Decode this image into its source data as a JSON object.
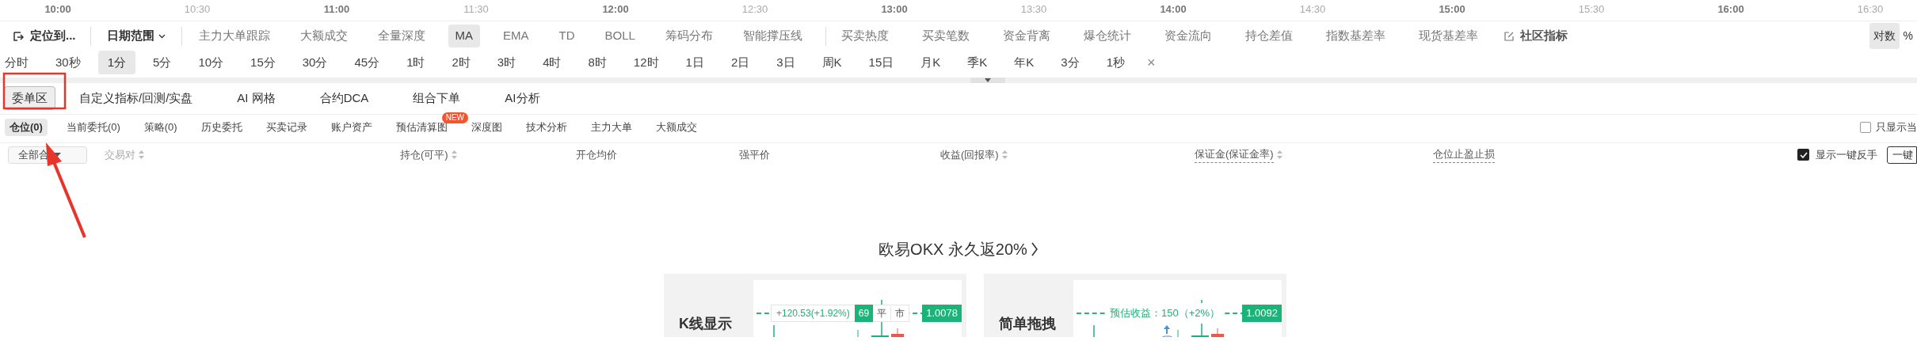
{
  "time_axis": [
    {
      "label": "10:00",
      "major": true
    },
    {
      "label": "10:30",
      "major": false
    },
    {
      "label": "11:00",
      "major": true
    },
    {
      "label": "11:30",
      "major": false
    },
    {
      "label": "12:00",
      "major": true
    },
    {
      "label": "12:30",
      "major": false
    },
    {
      "label": "13:00",
      "major": true
    },
    {
      "label": "13:30",
      "major": false
    },
    {
      "label": "14:00",
      "major": true
    },
    {
      "label": "14:30",
      "major": false
    },
    {
      "label": "15:00",
      "major": true
    },
    {
      "label": "15:30",
      "major": false
    },
    {
      "label": "16:00",
      "major": true
    },
    {
      "label": "16:30",
      "major": false
    }
  ],
  "toolbar": {
    "locate": "定位到...",
    "date_range": "日期范围",
    "indicators": [
      {
        "label": "主力大单跟踪",
        "selected": false
      },
      {
        "label": "大额成交",
        "selected": false
      },
      {
        "label": "全量深度",
        "selected": false
      },
      {
        "label": "MA",
        "selected": true
      },
      {
        "label": "EMA",
        "selected": false
      },
      {
        "label": "TD",
        "selected": false
      },
      {
        "label": "BOLL",
        "selected": false
      },
      {
        "label": "筹码分布",
        "selected": false
      },
      {
        "label": "智能撑压线",
        "selected": false
      }
    ],
    "data_tools": [
      {
        "label": "买卖热度",
        "selected": false
      },
      {
        "label": "买卖笔数",
        "selected": false
      },
      {
        "label": "资金背离",
        "selected": false
      },
      {
        "label": "爆仓统计",
        "selected": false
      },
      {
        "label": "资金流向",
        "selected": false
      },
      {
        "label": "持仓差值",
        "selected": false
      },
      {
        "label": "指数基差率",
        "selected": false
      },
      {
        "label": "现货基差率",
        "selected": false
      }
    ],
    "community": "社区指标",
    "scale_options": [
      {
        "label": "对数",
        "selected": true
      },
      {
        "label": "%",
        "selected": false
      }
    ]
  },
  "intervals": [
    {
      "label": "分时",
      "selected": false
    },
    {
      "label": "30秒",
      "selected": false
    },
    {
      "label": "1分",
      "selected": true
    },
    {
      "label": "5分",
      "selected": false
    },
    {
      "label": "10分",
      "selected": false
    },
    {
      "label": "15分",
      "selected": false
    },
    {
      "label": "30分",
      "selected": false
    },
    {
      "label": "45分",
      "selected": false
    },
    {
      "label": "1时",
      "selected": false
    },
    {
      "label": "2时",
      "selected": false
    },
    {
      "label": "3时",
      "selected": false
    },
    {
      "label": "4时",
      "selected": false
    },
    {
      "label": "8时",
      "selected": false
    },
    {
      "label": "12时",
      "selected": false
    },
    {
      "label": "1日",
      "selected": false
    },
    {
      "label": "2日",
      "selected": false
    },
    {
      "label": "3日",
      "selected": false
    },
    {
      "label": "周K",
      "selected": false
    },
    {
      "label": "15日",
      "selected": false
    },
    {
      "label": "月K",
      "selected": false
    },
    {
      "label": "季K",
      "selected": false
    },
    {
      "label": "年K",
      "selected": false
    },
    {
      "label": "3分",
      "selected": false
    },
    {
      "label": "1秒",
      "selected": false
    }
  ],
  "intervals_close": "×",
  "panel_tabs": [
    {
      "label": "委单区",
      "selected": true
    },
    {
      "label": "自定义指标/回测/实盘",
      "selected": false
    },
    {
      "label": "AI 网格",
      "selected": false
    },
    {
      "label": "合约DCA",
      "selected": false
    },
    {
      "label": "组合下单",
      "selected": false
    },
    {
      "label": "AI分析",
      "selected": false
    }
  ],
  "sub_tabs": [
    {
      "label": "仓位(0)",
      "selected": true
    },
    {
      "label": "当前委托(0)",
      "selected": false
    },
    {
      "label": "策略(0)",
      "selected": false
    },
    {
      "label": "历史委托",
      "selected": false
    },
    {
      "label": "买卖记录",
      "selected": false
    },
    {
      "label": "账户资产",
      "selected": false
    },
    {
      "label": "预估清算图",
      "selected": false,
      "badge": "NEW"
    },
    {
      "label": "深度图",
      "selected": false
    },
    {
      "label": "技术分析",
      "selected": false
    },
    {
      "label": "主力大单",
      "selected": false
    },
    {
      "label": "大额成交",
      "selected": false
    }
  ],
  "only_current": {
    "label": "只显示当",
    "checked": false
  },
  "positions_table": {
    "contract_filter": "全部合",
    "columns": [
      {
        "label": "交易对",
        "sortable": true,
        "underlined": false
      },
      {
        "label": "持仓(可平)",
        "sortable": true,
        "underlined": false
      },
      {
        "label": "开仓均价",
        "sortable": false,
        "underlined": false
      },
      {
        "label": "强平价",
        "sortable": false,
        "underlined": false
      },
      {
        "label": "收益(回报率)",
        "sortable": true,
        "underlined": false
      },
      {
        "label": "保证金(保证金率)",
        "sortable": true,
        "underlined": true
      },
      {
        "label": "仓位止盈止损",
        "sortable": false,
        "underlined": true
      }
    ],
    "show_reverse": {
      "label": "显示一键反手",
      "checked": true
    },
    "one_click_button": "一键"
  },
  "promo": {
    "title": "欧易OKX 永久返20%",
    "cards": [
      {
        "kind": "position",
        "heading": "K线显示",
        "profit": "+120.53(+1.92%)",
        "quantity": "69",
        "close_label": "平",
        "market_label": "市",
        "price": "1.0078"
      },
      {
        "kind": "drag",
        "heading": "简单拖拽",
        "estimate": "预估收益：150（+2%）",
        "price": "1.0092"
      }
    ]
  }
}
